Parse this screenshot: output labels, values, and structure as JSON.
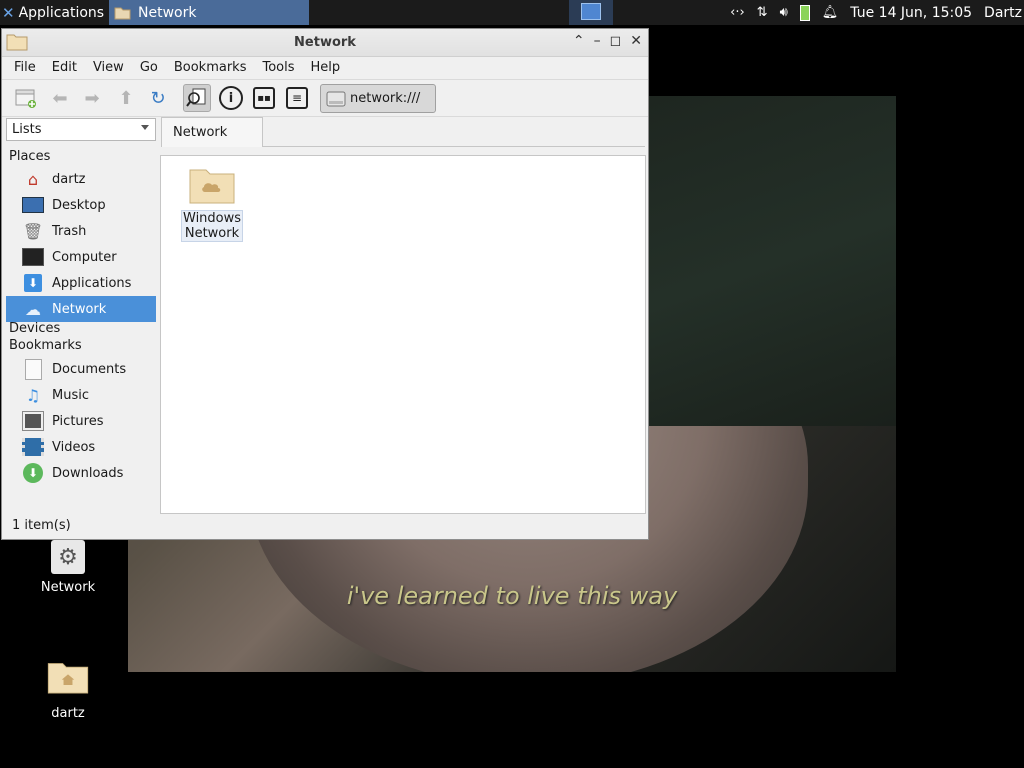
{
  "panel": {
    "applications_label": "Applications",
    "task_label": "Network",
    "clock": "Tue 14 Jun, 15:05",
    "user": "Dartz"
  },
  "wallpaper": {
    "subtitle": "i've learned to live this way"
  },
  "desktop": {
    "icons": [
      {
        "label": "Network",
        "icon": "gear-icon"
      },
      {
        "label": "dartz",
        "icon": "home-folder-icon"
      }
    ]
  },
  "window": {
    "title": "Network",
    "menu": [
      "File",
      "Edit",
      "View",
      "Go",
      "Bookmarks",
      "Tools",
      "Help"
    ],
    "location": "network:///",
    "side_pane_mode": "Lists",
    "sections": {
      "places": "Places",
      "devices": "Devices",
      "bookmarks": "Bookmarks"
    },
    "places": [
      {
        "label": "dartz",
        "icon": "home-icon"
      },
      {
        "label": "Desktop",
        "icon": "desktop-icon"
      },
      {
        "label": "Trash",
        "icon": "trash-icon"
      },
      {
        "label": "Computer",
        "icon": "computer-icon"
      },
      {
        "label": "Applications",
        "icon": "applications-icon"
      },
      {
        "label": "Network",
        "icon": "network-icon",
        "active": true
      }
    ],
    "bookmarks": [
      {
        "label": "Documents",
        "icon": "documents-icon"
      },
      {
        "label": "Music",
        "icon": "music-icon"
      },
      {
        "label": "Pictures",
        "icon": "pictures-icon"
      },
      {
        "label": "Videos",
        "icon": "videos-icon"
      },
      {
        "label": "Downloads",
        "icon": "downloads-icon"
      }
    ],
    "tab_label": "Network",
    "files": [
      {
        "line1": "Windows",
        "line2": "Network"
      }
    ],
    "status": "1 item(s)"
  },
  "colors": {
    "selection": "#4a90d9",
    "panel": "#1b1b1b",
    "task_active": "#4a6b99"
  }
}
